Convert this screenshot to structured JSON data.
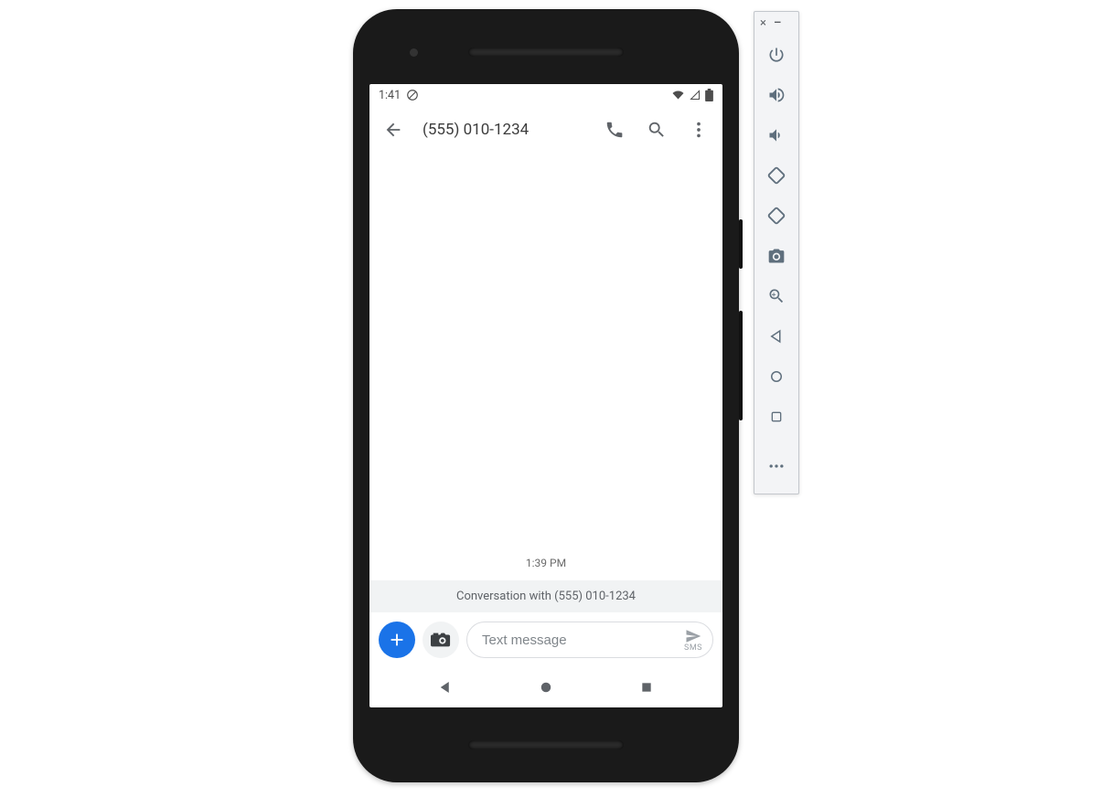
{
  "statusbar": {
    "time": "1:41"
  },
  "appbar": {
    "title": "(555) 010-1234"
  },
  "conversation": {
    "timestamp": "1:39 PM",
    "banner": "Conversation with (555) 010-1234"
  },
  "compose": {
    "placeholder": "Text message",
    "send_sub": "SMS"
  }
}
